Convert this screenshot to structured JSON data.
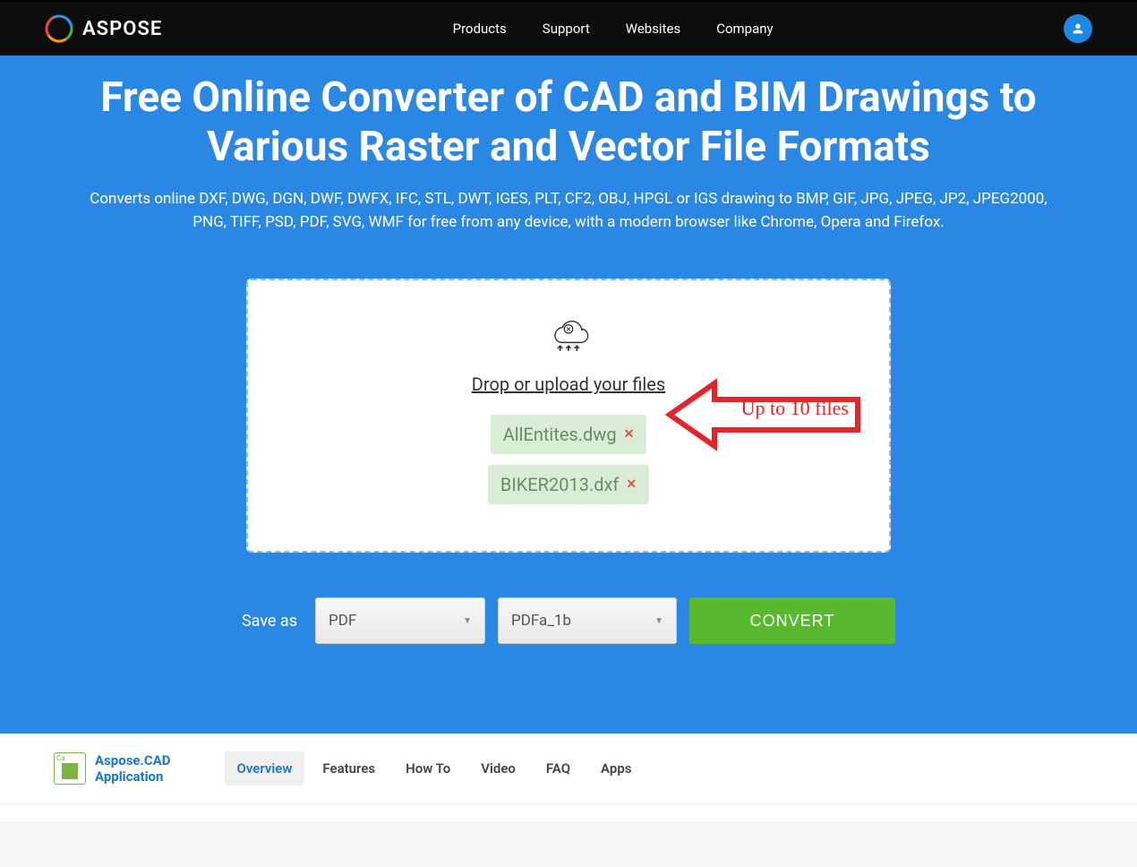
{
  "navbar": {
    "logo_text": "ASPOSE",
    "links": [
      "Products",
      "Support",
      "Websites",
      "Company"
    ]
  },
  "hero": {
    "title": "Free Online Converter of CAD and BIM Drawings to Various Raster and Vector File Formats",
    "subtitle": "Converts online DXF, DWG, DGN, DWF, DWFX, IFC, STL, DWT, IGES, PLT, CF2, OBJ, HPGL or IGS drawing to BMP, GIF, JPG, JPEG, JP2, JPEG2000, PNG, TIFF, PSD, PDF, SVG, WMF for free from any device, with a modern browser like Chrome, Opera and Firefox."
  },
  "upload": {
    "label": "Drop or upload your files",
    "files": [
      {
        "name": "AllEntites.dwg"
      },
      {
        "name": "BIKER2013.dxf"
      }
    ],
    "callout": "Up to 10 files"
  },
  "controls": {
    "save_as_label": "Save as",
    "format_primary": "PDF",
    "format_secondary": "PDFa_1b",
    "convert_label": "CONVERT"
  },
  "app": {
    "name_line1": "Aspose.CAD",
    "name_line2": "Application",
    "badge": "Ca",
    "tabs": [
      "Overview",
      "Features",
      "How To",
      "Video",
      "FAQ",
      "Apps"
    ],
    "active_tab_index": 0
  }
}
